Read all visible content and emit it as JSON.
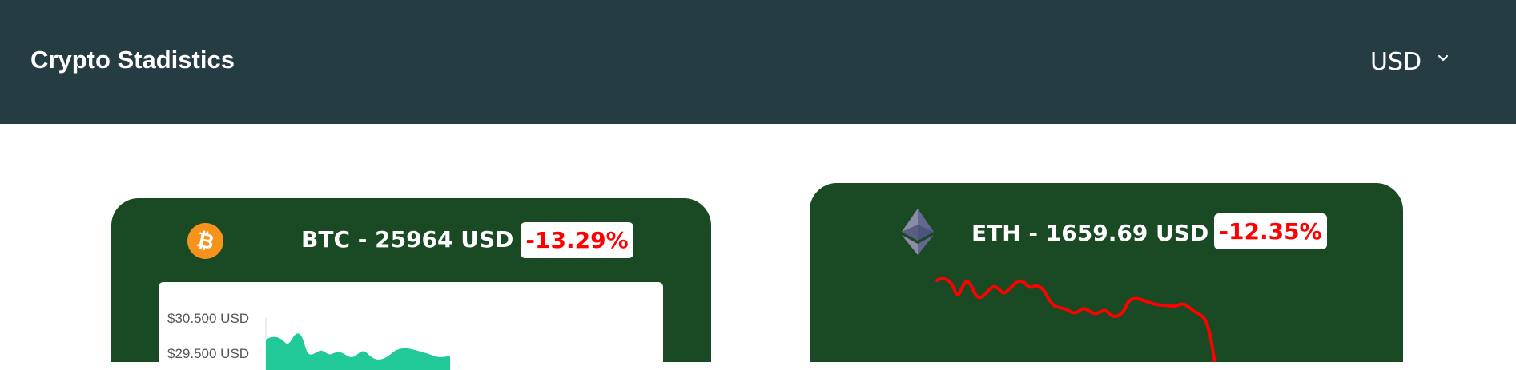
{
  "header": {
    "title": "Crypto Stadistics",
    "currency": "USD",
    "background": "#243c42"
  },
  "cards": [
    {
      "symbol_icon": "bitcoin-icon",
      "label": "BTC - 25964 USD",
      "change": "-13.29%",
      "background": "#1a4a24",
      "chart": {
        "type": "area",
        "color": "#20c997",
        "y_ticks": [
          "$30.500 USD",
          "$29.500 USD"
        ]
      }
    },
    {
      "symbol_icon": "ethereum-icon",
      "label": "ETH - 1659.69 USD",
      "change": "-12.35%",
      "background": "#1a4a24",
      "chart": {
        "type": "line",
        "color": "#ff0000"
      }
    }
  ]
}
